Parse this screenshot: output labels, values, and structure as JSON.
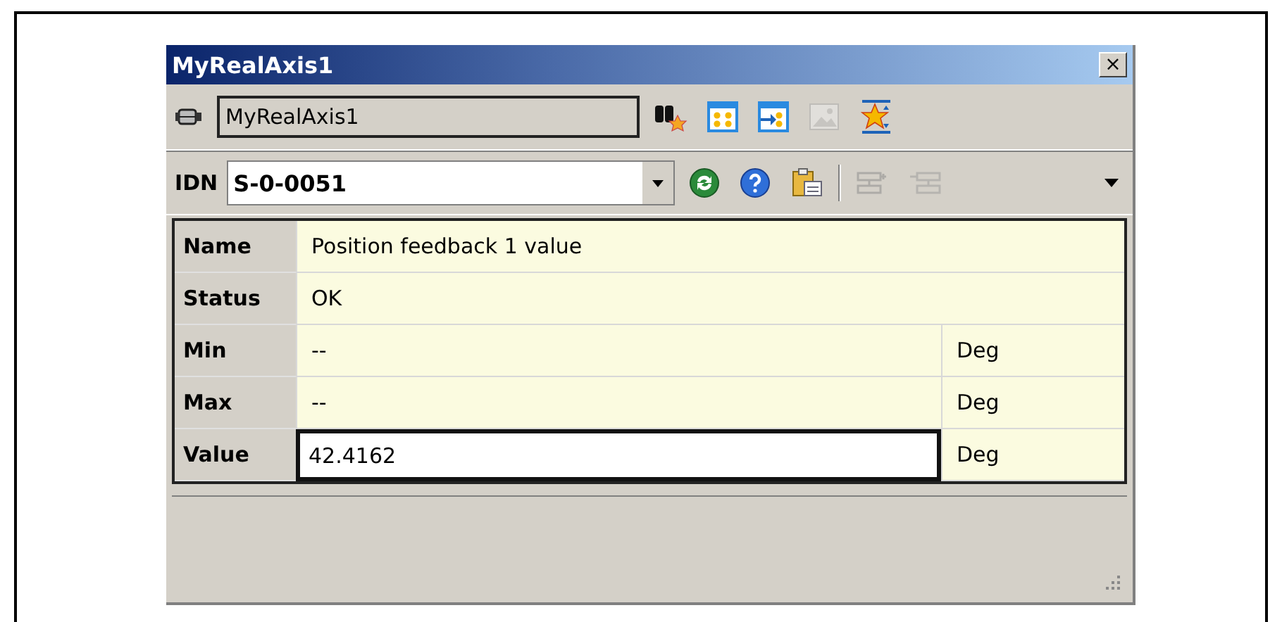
{
  "window": {
    "title": "MyRealAxis1",
    "close": "×"
  },
  "object_bar": {
    "name": "MyRealAxis1",
    "buttons": [
      {
        "disabled": false
      },
      {
        "disabled": false
      },
      {
        "disabled": false
      },
      {
        "disabled": true
      },
      {
        "disabled": false
      }
    ]
  },
  "idn_bar": {
    "label": "IDN",
    "value": "S-0-0051",
    "buttons": [
      {
        "disabled": false
      },
      {
        "disabled": false
      },
      {
        "disabled": false
      },
      {
        "disabled": true
      },
      {
        "disabled": true
      }
    ]
  },
  "properties": [
    {
      "kind": "text",
      "label": "Name",
      "value": "Position feedback 1 value"
    },
    {
      "kind": "text",
      "label": "Status",
      "value": "OK"
    },
    {
      "kind": "unit",
      "label": "Min",
      "value": "--",
      "unit": "Deg"
    },
    {
      "kind": "unit",
      "label": "Max",
      "value": "--",
      "unit": "Deg"
    },
    {
      "kind": "edit",
      "label": "Value",
      "value": "42.4162",
      "unit": "Deg"
    }
  ]
}
